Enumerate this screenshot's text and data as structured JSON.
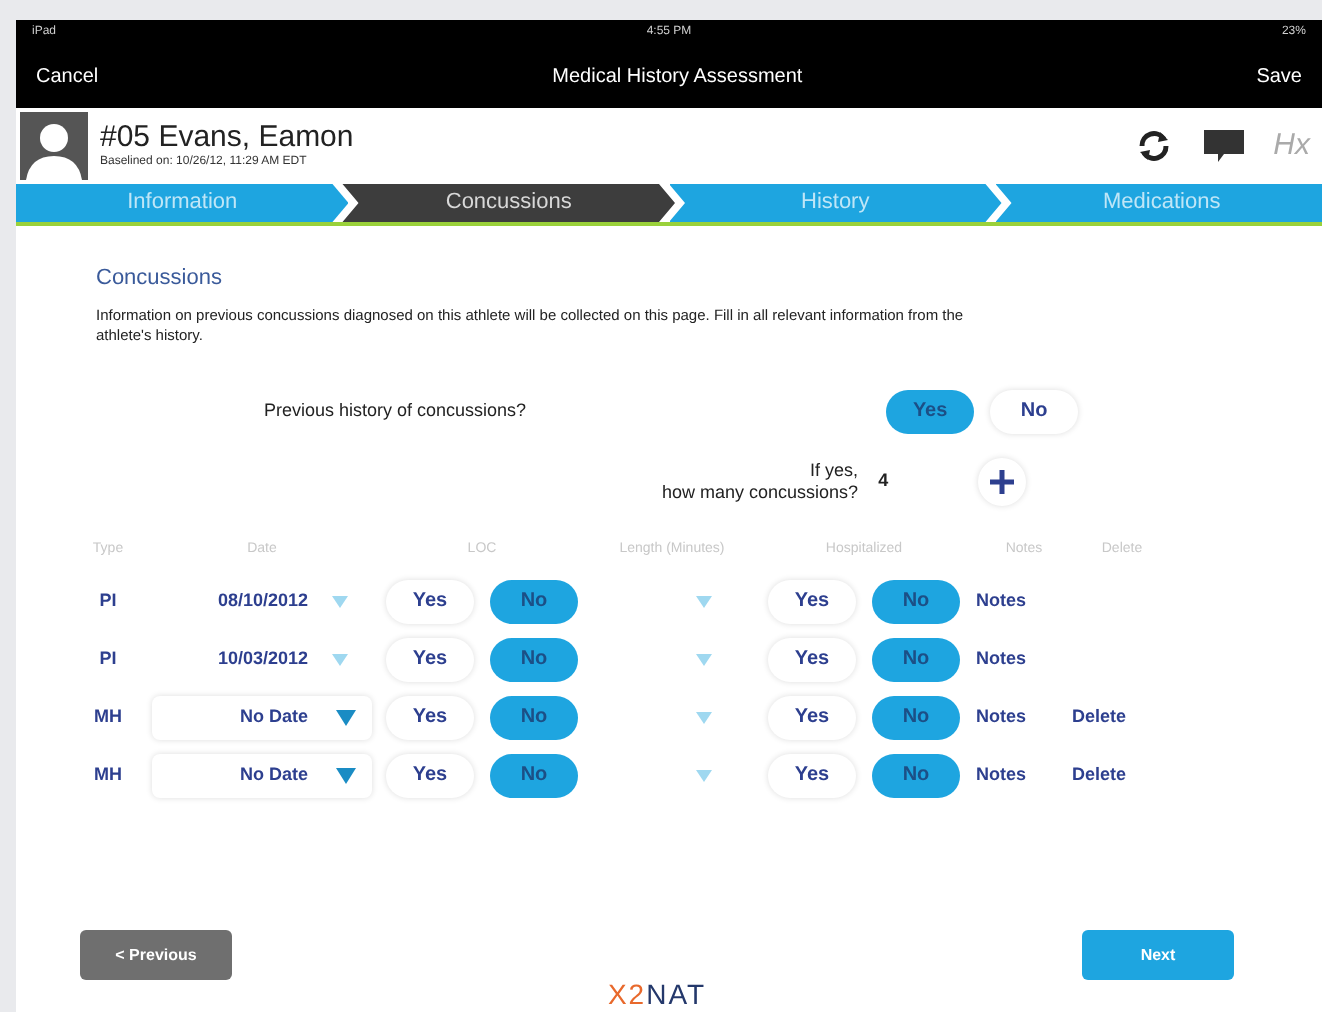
{
  "status_bar": {
    "device": "iPad",
    "time": "4:55 PM",
    "battery": "23%"
  },
  "nav_bar": {
    "cancel": "Cancel",
    "title": "Medical History Assessment",
    "save": "Save"
  },
  "athlete": {
    "name": "#05 Evans, Eamon",
    "baseline": "Baselined on: 10/26/12, 11:29 AM EDT",
    "hx": "Hx"
  },
  "tabs": [
    {
      "label": "Information",
      "selected": false
    },
    {
      "label": "Concussions",
      "selected": true
    },
    {
      "label": "History",
      "selected": false
    },
    {
      "label": "Medications",
      "selected": false
    }
  ],
  "section": {
    "title": "Concussions",
    "description": "Information on previous concussions diagnosed on this athlete will be collected on this page. Fill in all relevant information from the athlete's history."
  },
  "history_question": {
    "label": "Previous history of concussions?",
    "options": [
      {
        "label": "Yes",
        "selected": true
      },
      {
        "label": "No",
        "selected": false
      }
    ]
  },
  "count_question": {
    "label_line_1": "If yes,",
    "label_line_2": "how many concussions?",
    "value": "4"
  },
  "table": {
    "columns": [
      "Type",
      "Date",
      "LOC",
      "Length (Minutes)",
      "Hospitalized",
      "Notes",
      "Delete"
    ],
    "rows": [
      {
        "kind": "plain",
        "type": "PI",
        "date": "08/10/2012",
        "loc": [
          {
            "label": "Yes",
            "selected": false
          },
          {
            "label": "No",
            "selected": true
          }
        ],
        "hospitalized": [
          {
            "label": "Yes",
            "selected": false
          },
          {
            "label": "No",
            "selected": true
          }
        ],
        "notes": "Notes"
      },
      {
        "kind": "plain",
        "type": "PI",
        "date": "10/03/2012",
        "loc": [
          {
            "label": "Yes",
            "selected": false
          },
          {
            "label": "No",
            "selected": true
          }
        ],
        "hospitalized": [
          {
            "label": "Yes",
            "selected": false
          },
          {
            "label": "No",
            "selected": true
          }
        ],
        "notes": "Notes"
      },
      {
        "kind": "dropdown",
        "type": "MH",
        "date": "No Date",
        "loc": [
          {
            "label": "Yes",
            "selected": false
          },
          {
            "label": "No",
            "selected": true
          }
        ],
        "hospitalized": [
          {
            "label": "Yes",
            "selected": false
          },
          {
            "label": "No",
            "selected": true
          }
        ],
        "notes": "Notes",
        "delete": "Delete"
      },
      {
        "kind": "dropdown",
        "type": "MH",
        "date": "No Date",
        "loc": [
          {
            "label": "Yes",
            "selected": false
          },
          {
            "label": "No",
            "selected": true
          }
        ],
        "hospitalized": [
          {
            "label": "Yes",
            "selected": false
          },
          {
            "label": "No",
            "selected": true
          }
        ],
        "notes": "Notes",
        "delete": "Delete"
      }
    ]
  },
  "footer": {
    "previous": "< Previous",
    "next": "Next",
    "logo_accent": "X2",
    "logo_name": "NAT"
  }
}
